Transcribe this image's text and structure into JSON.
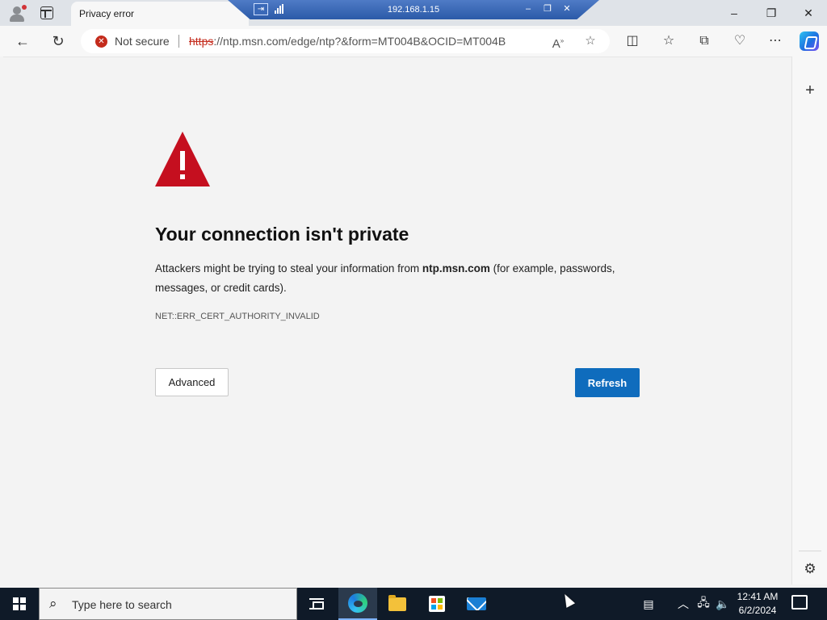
{
  "tab": {
    "title": "Privacy error"
  },
  "remote": {
    "address": "192.168.1.15"
  },
  "toolbar": {
    "security_label": "Not secure",
    "url_scheme": "https",
    "url_rest": "://ntp.msn.com/edge/ntp?&form=MT004B&OCID=MT004B"
  },
  "error": {
    "title": "Your connection isn't private",
    "desc_prefix": "Attackers might be trying to steal your information from ",
    "desc_host": "ntp.msn.com",
    "desc_suffix": " (for example, passwords, messages, or credit cards).",
    "code": "NET::ERR_CERT_AUTHORITY_INVALID",
    "advanced_label": "Advanced",
    "refresh_label": "Refresh"
  },
  "taskbar": {
    "search_placeholder": "Type here to search",
    "time": "12:41 AM",
    "date": "6/2/2024"
  },
  "colors": {
    "warning_red": "#c50f1f",
    "primary_blue": "#0f6cbd",
    "not_secure_red": "#c42b1c"
  }
}
